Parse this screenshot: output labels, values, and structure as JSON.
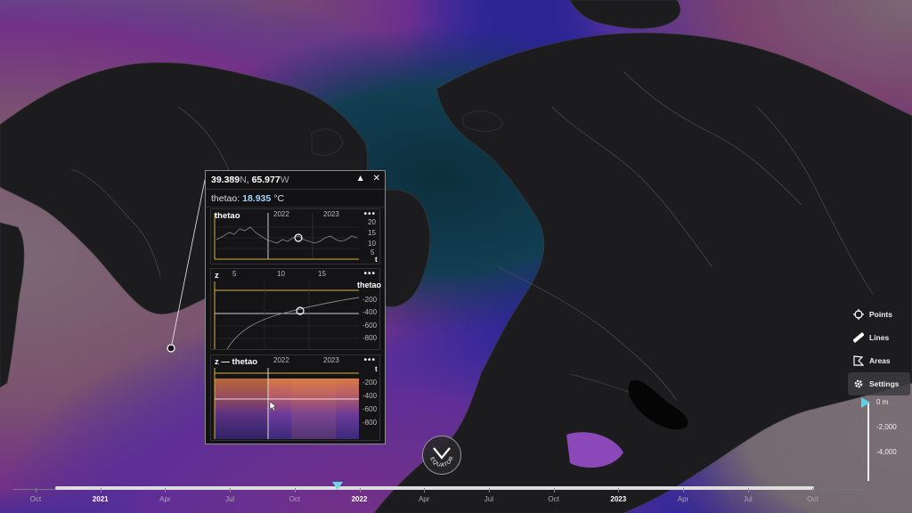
{
  "probe": {
    "lat": "39.389",
    "lat_hemi": "N",
    "lon": "65.977",
    "lon_hemi": "W",
    "collapse_icon": "caret-up-icon",
    "close_icon": "close-icon",
    "variable": "thetao",
    "value": "18.935",
    "unit": "°C",
    "timeseries": {
      "title": "thetao",
      "years": [
        "2022",
        "2023"
      ],
      "yticks": [
        "20",
        "15",
        "10",
        "5"
      ],
      "axis_label": "t",
      "more": "•••"
    },
    "profile": {
      "title": "z",
      "series_label": "thetao",
      "xticks": [
        "5",
        "10",
        "15"
      ],
      "yticks": [
        "-200",
        "-400",
        "-600",
        "-800"
      ],
      "more": "•••"
    },
    "section": {
      "title": "z — thetao",
      "years": [
        "2022",
        "2023"
      ],
      "yticks": [
        "-200",
        "-400",
        "-600",
        "-800"
      ],
      "axis_label": "t",
      "more": "•••"
    }
  },
  "tools": [
    {
      "label": "Points",
      "icon": "crosshair-icon",
      "active": false
    },
    {
      "label": "Lines",
      "icon": "ruler-icon",
      "active": false
    },
    {
      "label": "Areas",
      "icon": "polygon-icon",
      "active": false
    },
    {
      "label": "Settings",
      "icon": "gear-icon",
      "active": true
    }
  ],
  "depth_scale": {
    "labels": [
      "0 m",
      "-2,000",
      "-4,000"
    ]
  },
  "compass": {
    "label": "EQUATOR"
  },
  "timeline": {
    "labels": [
      {
        "text": "Oct",
        "year": false
      },
      {
        "text": "2021",
        "year": true
      },
      {
        "text": "Apr",
        "year": false
      },
      {
        "text": "Jul",
        "year": false
      },
      {
        "text": "Oct",
        "year": false
      },
      {
        "text": "2022",
        "year": true
      },
      {
        "text": "Apr",
        "year": false
      },
      {
        "text": "Jul",
        "year": false
      },
      {
        "text": "Oct",
        "year": false
      },
      {
        "text": "2023",
        "year": true
      },
      {
        "text": "Apr",
        "year": false
      },
      {
        "text": "Jul",
        "year": false
      },
      {
        "text": "Oct",
        "year": false
      }
    ]
  },
  "colors": {
    "warm": "#f5a83a",
    "hot": "#f3e24a",
    "mid": "#e0457a",
    "cool": "#5a3fc4",
    "cold": "#2a1f8c",
    "ice": "#0f3a4a",
    "land": "#1c1c1e",
    "accent": "#6fd6e6"
  }
}
